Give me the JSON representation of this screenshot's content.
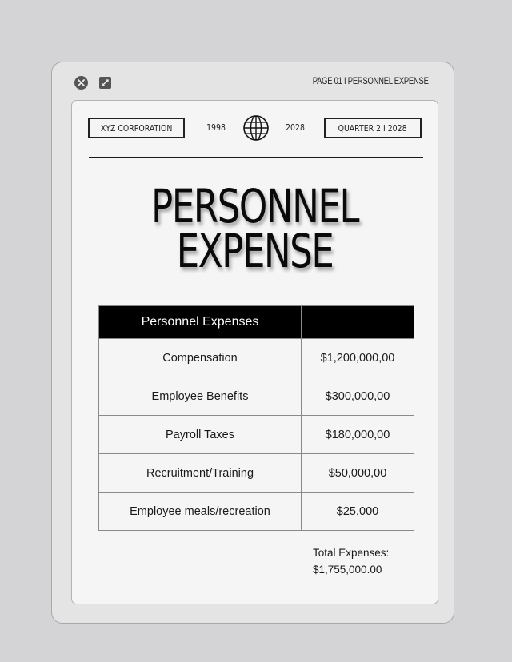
{
  "window": {
    "page_label": "PAGE 01 I PERSONNEL EXPENSE",
    "icons": {
      "close": "close-circle-icon",
      "expand": "expand-icon"
    }
  },
  "header": {
    "company": "XYZ  CORPORATION",
    "year_start": "1998",
    "year_end": "2028",
    "quarter": "QUARTER 2 I 2028",
    "icon": "globe-icon"
  },
  "title": {
    "line1": "PERSONNEL",
    "line2": "EXPENSE"
  },
  "table": {
    "headers": [
      "Personnel Expenses",
      ""
    ],
    "rows": [
      {
        "item": "Compensation",
        "amount": "$1,200,000,00"
      },
      {
        "item": "Employee Benefits",
        "amount": "$300,000,00"
      },
      {
        "item": "Payroll Taxes",
        "amount": "$180,000,00"
      },
      {
        "item": "Recruitment/Training",
        "amount": "$50,000,00"
      },
      {
        "item": "Employee meals/recreation",
        "amount": "$25,000"
      }
    ]
  },
  "total": {
    "label": "Total Expenses:",
    "value": "$1,755,000.00"
  },
  "colors": {
    "background": "#d4d4d6",
    "window": "#e4e4e5",
    "sheet": "#f5f5f5",
    "header_fill": "#000000"
  }
}
